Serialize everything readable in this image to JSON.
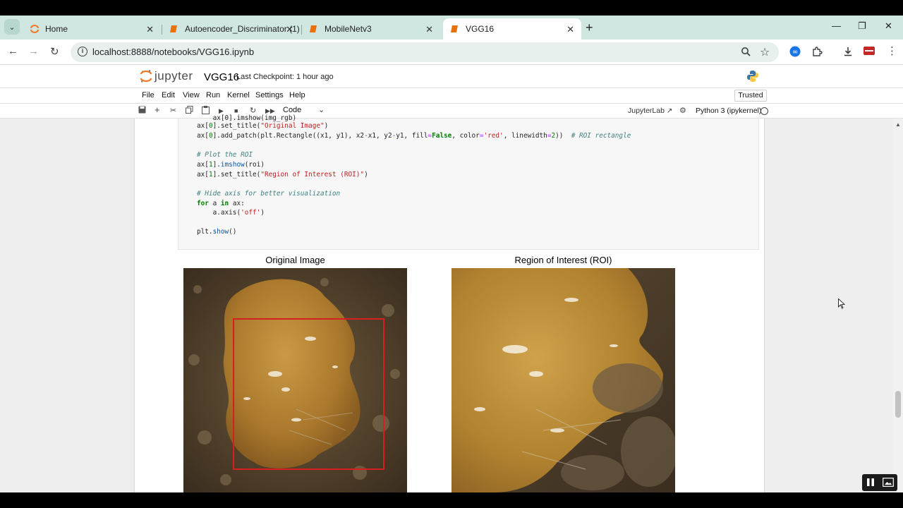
{
  "browser": {
    "tabs": [
      {
        "label": "Home",
        "icon": "jupyter-home-icon",
        "active": false
      },
      {
        "label": "Autoencoder_Discriminator (1)",
        "icon": "notebook-icon",
        "active": false
      },
      {
        "label": "MobileNetv3",
        "icon": "notebook-icon",
        "active": false
      },
      {
        "label": "VGG16",
        "icon": "notebook-icon",
        "active": true
      }
    ],
    "url": "localhost:8888/notebooks/VGG16.ipynb"
  },
  "jupyter": {
    "wordmark": "jupyter",
    "notebook_title": "VGG16",
    "checkpoint": "Last Checkpoint: 1 hour ago",
    "menu": [
      "File",
      "Edit",
      "View",
      "Run",
      "Kernel",
      "Settings",
      "Help"
    ],
    "trusted": "Trusted",
    "cell_type": "Code",
    "jupyterlab": "JupyterLab",
    "kernel": "Python 3 (ipykernel)"
  },
  "code": {
    "line_partial": "    ax[0].imshow(img_rgb)",
    "comment_plot_roi": "# Plot the ROI",
    "comment_hide_axis": "# Hide axis for better visualization",
    "comment_roi_rect": "# ROI rectangle"
  },
  "figure": {
    "left_title": "Original Image",
    "right_title": "Region of Interest (ROI)",
    "accent": "#d62020"
  }
}
